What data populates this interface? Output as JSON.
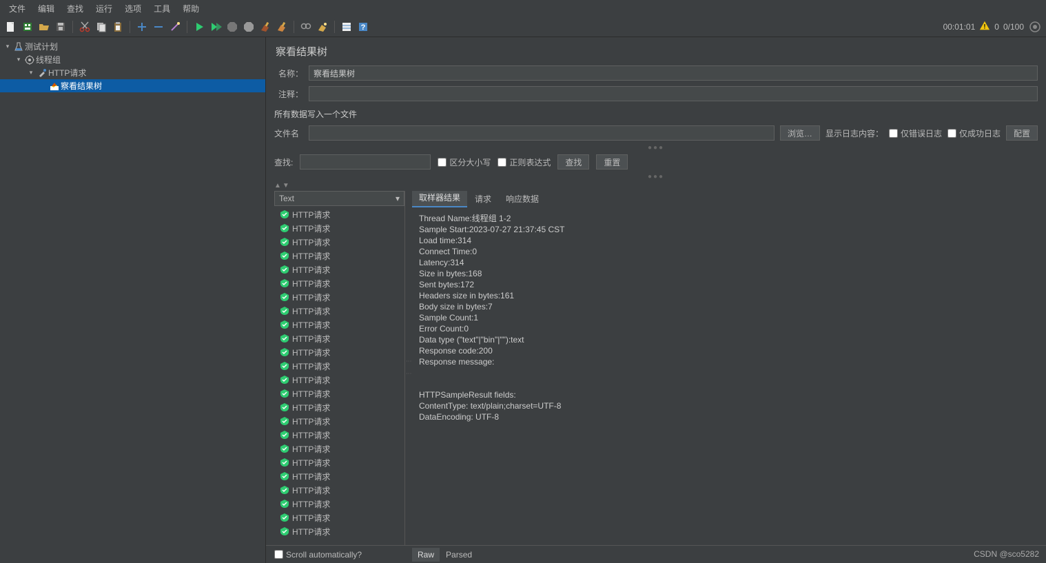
{
  "menu": [
    "文件",
    "编辑",
    "查找",
    "运行",
    "选项",
    "工具",
    "帮助"
  ],
  "status": {
    "time": "00:01:01",
    "warn": "0",
    "threads": "0/100"
  },
  "tree": {
    "plan": "测试计划",
    "group": "线程组",
    "sampler": "HTTP请求",
    "listener": "察看结果树"
  },
  "panel": {
    "title": "察看结果树",
    "name_label": "名称：",
    "name_value": "察看结果树",
    "comment_label": "注释：",
    "section": "所有数据写入一个文件",
    "filename_label": "文件名",
    "browse": "浏览…",
    "show_log": "显示日志内容：",
    "only_err": "仅错误日志",
    "only_ok": "仅成功日志",
    "config": "配置"
  },
  "search": {
    "label": "查找:",
    "case": "区分大小写",
    "regex": "正则表达式",
    "find": "查找",
    "reset": "重置"
  },
  "renderer": "Text",
  "sample_label": "HTTP请求",
  "sample_count": 24,
  "tabs": [
    "取样器结果",
    "请求",
    "响应数据"
  ],
  "detail_lines": [
    "Thread Name:线程组 1-2",
    "Sample Start:2023-07-27 21:37:45 CST",
    "Load time:314",
    "Connect Time:0",
    "Latency:314",
    "Size in bytes:168",
    "Sent bytes:172",
    "Headers size in bytes:161",
    "Body size in bytes:7",
    "Sample Count:1",
    "Error Count:0",
    "Data type (\"text\"|\"bin\"|\"\"):text",
    "Response code:200",
    "Response message:",
    "",
    "",
    "HTTPSampleResult fields:",
    "ContentType: text/plain;charset=UTF-8",
    "DataEncoding: UTF-8"
  ],
  "scroll_auto": "Scroll automatically?",
  "bottom_tabs": [
    "Raw",
    "Parsed"
  ],
  "watermark": "CSDN @sco5282"
}
